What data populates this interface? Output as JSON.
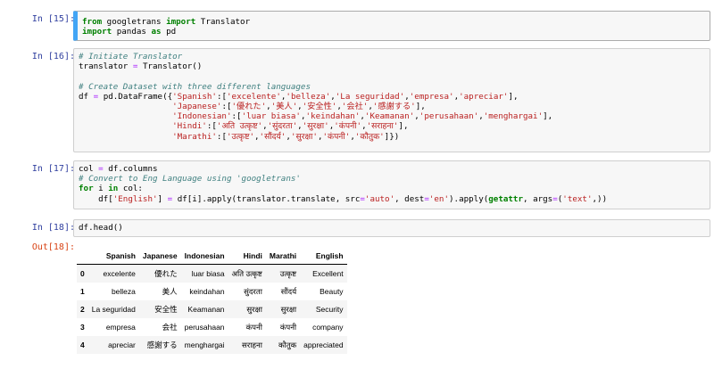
{
  "cells": {
    "c15": {
      "prompt": "In [15]:",
      "lines": [
        [
          [
            "from",
            "kw"
          ],
          [
            " googletrans ",
            ""
          ],
          [
            "import",
            "kw"
          ],
          [
            " Translator",
            ""
          ]
        ],
        [
          [
            "import",
            "kw"
          ],
          [
            " pandas ",
            ""
          ],
          [
            "as",
            "kw"
          ],
          [
            " pd",
            ""
          ]
        ]
      ]
    },
    "c16": {
      "prompt": "In [16]:",
      "lines": [
        [
          [
            "# Initiate Translator",
            "cm"
          ]
        ],
        [
          [
            "translator ",
            ""
          ],
          [
            "=",
            "op"
          ],
          [
            " Translator()",
            ""
          ]
        ],
        [
          [
            "",
            ""
          ]
        ],
        [
          [
            "# Create Dataset with three different languages",
            "cm"
          ]
        ],
        [
          [
            "df ",
            ""
          ],
          [
            "=",
            "op"
          ],
          [
            " pd.DataFrame({",
            ""
          ],
          [
            "'Spanish'",
            "str"
          ],
          [
            ":[",
            ""
          ],
          [
            "'excelente'",
            "str"
          ],
          [
            ",",
            ""
          ],
          [
            "'belleza'",
            "str"
          ],
          [
            ",",
            ""
          ],
          [
            "'La seguridad'",
            "str"
          ],
          [
            ",",
            ""
          ],
          [
            "'empresa'",
            "str"
          ],
          [
            ",",
            ""
          ],
          [
            "'apreciar'",
            "str"
          ],
          [
            "],",
            ""
          ]
        ],
        [
          [
            "                   ",
            ""
          ],
          [
            "'Japanese'",
            "str"
          ],
          [
            ":[",
            ""
          ],
          [
            "'優れた'",
            "str"
          ],
          [
            ",",
            ""
          ],
          [
            "'美人'",
            "str"
          ],
          [
            ",",
            ""
          ],
          [
            "'安全性'",
            "str"
          ],
          [
            ",",
            ""
          ],
          [
            "'会社'",
            "str"
          ],
          [
            ",",
            ""
          ],
          [
            "'感謝する'",
            "str"
          ],
          [
            "],",
            ""
          ]
        ],
        [
          [
            "                   ",
            ""
          ],
          [
            "'Indonesian'",
            "str"
          ],
          [
            ":[",
            ""
          ],
          [
            "'luar biasa'",
            "str"
          ],
          [
            ",",
            ""
          ],
          [
            "'keindahan'",
            "str"
          ],
          [
            ",",
            ""
          ],
          [
            "'Keamanan'",
            "str"
          ],
          [
            ",",
            ""
          ],
          [
            "'perusahaan'",
            "str"
          ],
          [
            ",",
            ""
          ],
          [
            "'menghargai'",
            "str"
          ],
          [
            "],",
            ""
          ]
        ],
        [
          [
            "                   ",
            ""
          ],
          [
            "'Hindi'",
            "str"
          ],
          [
            ":[",
            ""
          ],
          [
            "'अति उत्कृष्ट'",
            "str"
          ],
          [
            ",",
            ""
          ],
          [
            "'सुंदरता'",
            "str"
          ],
          [
            ",",
            ""
          ],
          [
            "'सुरक्षा'",
            "str"
          ],
          [
            ",",
            ""
          ],
          [
            "'कंपनी'",
            "str"
          ],
          [
            ",",
            ""
          ],
          [
            "'सराहना'",
            "str"
          ],
          [
            "],",
            ""
          ]
        ],
        [
          [
            "                   ",
            ""
          ],
          [
            "'Marathi'",
            "str"
          ],
          [
            ":[",
            ""
          ],
          [
            "'उत्कृष्ट'",
            "str"
          ],
          [
            ",",
            ""
          ],
          [
            "'सौंदर्य'",
            "str"
          ],
          [
            ",",
            ""
          ],
          [
            "'सुरक्षा'",
            "str"
          ],
          [
            ",",
            ""
          ],
          [
            "'कंपनी'",
            "str"
          ],
          [
            ",",
            ""
          ],
          [
            "'कौतुक'",
            "str"
          ],
          [
            "]})",
            ""
          ]
        ]
      ]
    },
    "c17": {
      "prompt": "In [17]:",
      "lines": [
        [
          [
            "col ",
            ""
          ],
          [
            "=",
            "op"
          ],
          [
            " df.columns",
            ""
          ]
        ],
        [
          [
            "# Convert to Eng Language using 'googletrans'",
            "cm"
          ]
        ],
        [
          [
            "for",
            "kw"
          ],
          [
            " i ",
            ""
          ],
          [
            "in",
            "kw"
          ],
          [
            " col:",
            ""
          ]
        ],
        [
          [
            "    df[",
            ""
          ],
          [
            "'English'",
            "str"
          ],
          [
            "] ",
            ""
          ],
          [
            "=",
            "op"
          ],
          [
            " df[i].apply(translator.translate, src",
            ""
          ],
          [
            "=",
            "op"
          ],
          [
            "'auto'",
            "str"
          ],
          [
            ", dest",
            ""
          ],
          [
            "=",
            "op"
          ],
          [
            "'en'",
            "str"
          ],
          [
            ").apply(",
            ""
          ],
          [
            "getattr",
            "kw"
          ],
          [
            ", args",
            ""
          ],
          [
            "=",
            "op"
          ],
          [
            "(",
            ""
          ],
          [
            "'text'",
            "str"
          ],
          [
            ",))",
            ""
          ]
        ]
      ]
    },
    "c18": {
      "prompt": "In [18]:",
      "lines": [
        [
          [
            "df.head()",
            ""
          ]
        ]
      ],
      "out_prompt": "Out[18]:"
    }
  },
  "dataframe": {
    "columns": [
      "",
      "Spanish",
      "Japanese",
      "Indonesian",
      "Hindi",
      "Marathi",
      "English"
    ],
    "rows": [
      [
        "0",
        "excelente",
        "優れた",
        "luar biasa",
        "अति उत्कृष्ट",
        "उत्कृष्ट",
        "Excellent"
      ],
      [
        "1",
        "belleza",
        "美人",
        "keindahan",
        "सुंदरता",
        "सौंदर्य",
        "Beauty"
      ],
      [
        "2",
        "La seguridad",
        "安全性",
        "Keamanan",
        "सुरक्षा",
        "सुरक्षा",
        "Security"
      ],
      [
        "3",
        "empresa",
        "会社",
        "perusahaan",
        "कंपनी",
        "कंपनी",
        "company"
      ],
      [
        "4",
        "apreciar",
        "感謝する",
        "menghargai",
        "सराहना",
        "कौतुक",
        "appreciated"
      ]
    ]
  },
  "colors": {
    "in_prompt": "#303f9f",
    "out_prompt": "#d84315",
    "selected_bar": "#42a5f5"
  }
}
